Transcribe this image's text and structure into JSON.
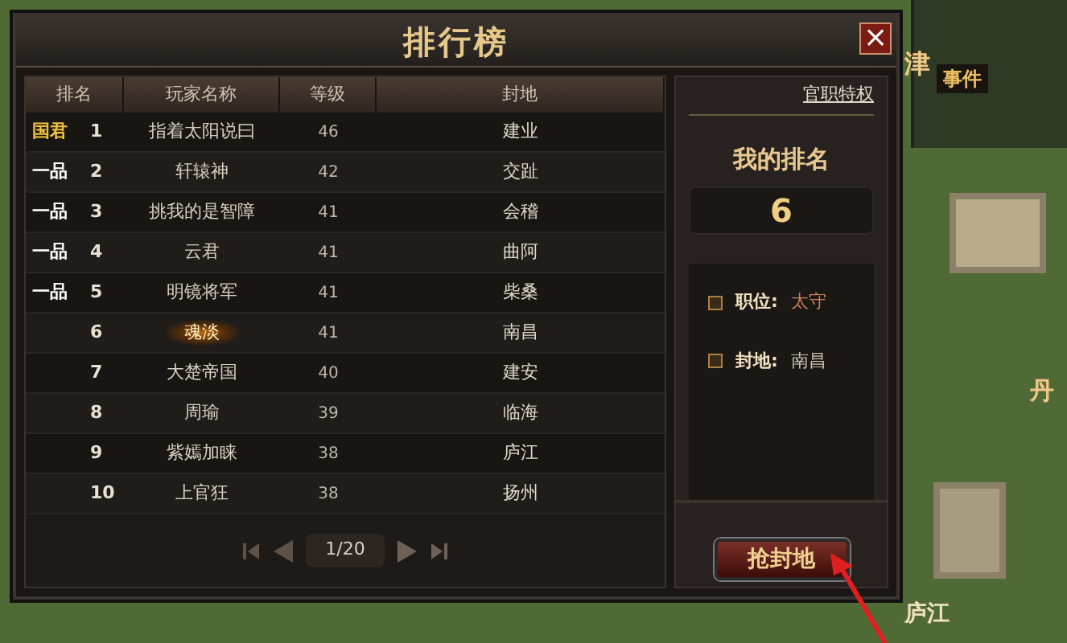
{
  "window": {
    "title": "排行榜",
    "close": "×"
  },
  "table": {
    "columns": [
      "排名",
      "玩家名称",
      "等级",
      "封地"
    ],
    "rows": [
      {
        "badge": "国君",
        "color": "#f0c040",
        "rank": "1",
        "name": "指着太阳说曰",
        "level": "46",
        "fief": "建业",
        "selected": false
      },
      {
        "badge": "一品",
        "color": "#ffffff",
        "rank": "2",
        "name": "轩辕神",
        "level": "42",
        "fief": "交趾",
        "selected": false
      },
      {
        "badge": "一品",
        "color": "#ffffff",
        "rank": "3",
        "name": "挑我的是智障",
        "level": "41",
        "fief": "会稽",
        "selected": false
      },
      {
        "badge": "一品",
        "color": "#ffffff",
        "rank": "4",
        "name": "云君",
        "level": "41",
        "fief": "曲阿",
        "selected": false
      },
      {
        "badge": "一品",
        "color": "#ffffff",
        "rank": "5",
        "name": "明镜将军",
        "level": "41",
        "fief": "柴桑",
        "selected": false
      },
      {
        "rank": "6",
        "name": "魂淡",
        "level": "41",
        "fief": "南昌",
        "selected": true
      },
      {
        "rank": "7",
        "name": "大楚帝国",
        "level": "40",
        "fief": "建安",
        "selected": false
      },
      {
        "rank": "8",
        "name": "周瑜",
        "level": "39",
        "fief": "临海",
        "selected": false
      },
      {
        "rank": "9",
        "name": "紫嫣加睐",
        "level": "38",
        "fief": "庐江",
        "selected": false
      },
      {
        "rank": "10",
        "name": "上官狂",
        "level": "38",
        "fief": "扬州",
        "selected": false
      }
    ]
  },
  "pagination": {
    "page": "1/20"
  },
  "side_panel": {
    "link": "官职特权",
    "my_rank_label": "我的排名",
    "my_rank": "6",
    "info": [
      {
        "label": "职位:",
        "value": "太守",
        "color": "#c9805a"
      },
      {
        "label": "封地:",
        "value": "南昌",
        "color": "#c8c0b0"
      }
    ],
    "button": "抢封地"
  },
  "map": {
    "labels": [
      "津",
      "事件",
      "丹",
      "庐江"
    ]
  }
}
